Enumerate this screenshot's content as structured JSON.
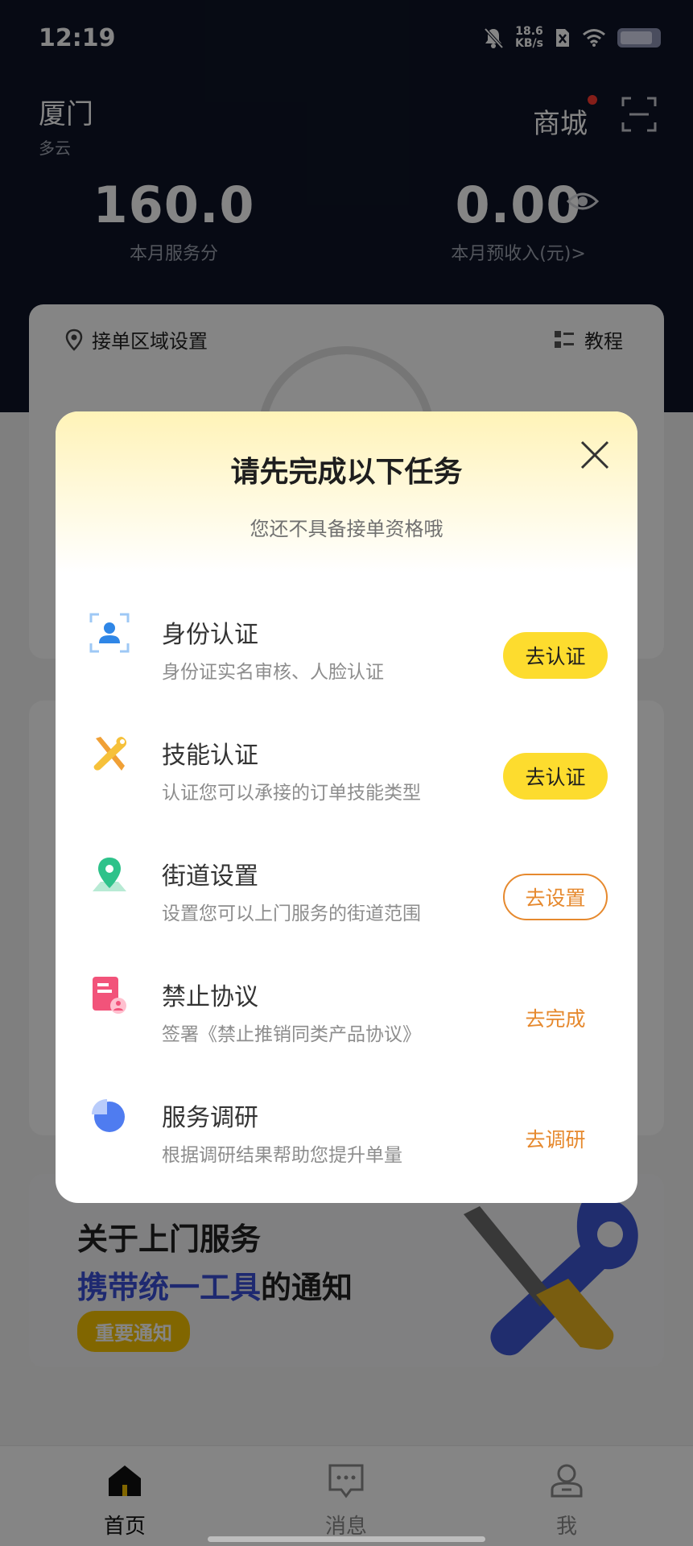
{
  "status_bar": {
    "time": "12:19",
    "net_speed_value": "18.6",
    "net_speed_unit": "KB/s",
    "battery_level": 0.85
  },
  "header": {
    "city": "厦门",
    "weather": "多云",
    "mall_label": "商城",
    "service_score": "160.0",
    "service_score_label": "本月服务分",
    "income": "0.00",
    "income_label": "本月预收入(元)>"
  },
  "area_card": {
    "title": "接单区域设置",
    "tutorial_label": "教程"
  },
  "notice": {
    "line1": "关于上门服务",
    "line2_highlight": "携带统一工具",
    "line2_rest": "的通知",
    "tag": "重要通知"
  },
  "modal": {
    "title": "请先完成以下任务",
    "subtitle": "您还不具备接单资格哦",
    "tasks": [
      {
        "name": "身份认证",
        "desc": "身份证实名审核、人脸认证",
        "action": "去认证",
        "icon": "id-card-icon"
      },
      {
        "name": "技能认证",
        "desc": "认证您可以承接的订单技能类型",
        "action": "去认证",
        "icon": "tools-icon"
      },
      {
        "name": "街道设置",
        "desc": "设置您可以上门服务的街道范围",
        "action": "去设置",
        "icon": "map-pin-icon"
      },
      {
        "name": "禁止协议",
        "desc": "签署《禁止推销同类产品协议》",
        "action": "去完成",
        "icon": "agreement-icon"
      },
      {
        "name": "服务调研",
        "desc": "根据调研结果帮助您提升单量",
        "action": "去调研",
        "icon": "pie-chart-icon"
      }
    ]
  },
  "tab_bar": {
    "home": "首页",
    "messages": "消息",
    "me": "我"
  },
  "colors": {
    "header_bg": "#0e1527",
    "primary_yellow": "#fddc2e",
    "accent_orange": "#e6892e",
    "highlight_blue": "#3a4fd6"
  }
}
